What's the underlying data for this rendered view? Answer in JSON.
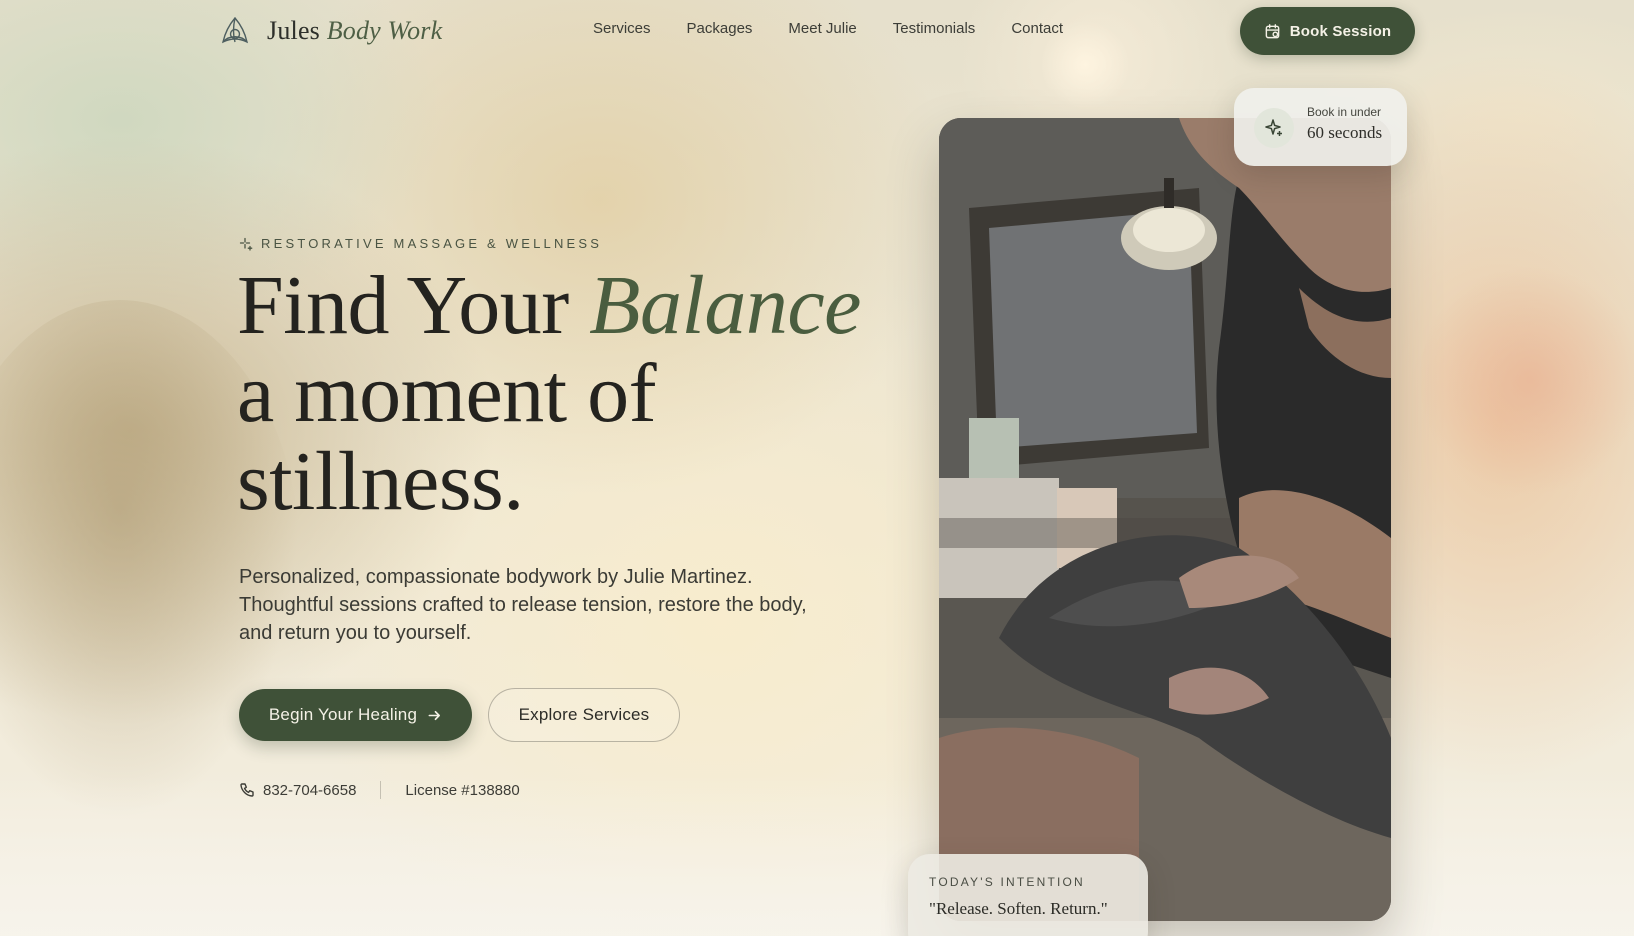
{
  "brand": {
    "name_first": "Jules",
    "name_second": "Body Work",
    "icon": "triquetra-icon"
  },
  "nav": {
    "links": [
      "Services",
      "Packages",
      "Meet Julie",
      "Testimonials",
      "Contact"
    ],
    "book_label": "Book Session",
    "book_icon": "calendar-icon"
  },
  "hero": {
    "eyebrow": "RESTORATIVE MASSAGE & WELLNESS",
    "headline_part1": "Find Your ",
    "headline_accent": "Balance",
    "headline_line2": "a moment of",
    "headline_line3": "stillness.",
    "lede": "Personalized, compassionate bodywork by Julie Martinez. Thoughtful sessions crafted to release tension, restore the body, and return you to yourself.",
    "cta_primary": "Begin Your Healing",
    "cta_secondary": "Explore Services",
    "phone": "832-704-6658",
    "license": "License #138880"
  },
  "badge": {
    "small": "Book in under",
    "big": "60 seconds",
    "icon": "sparkle-icon"
  },
  "intention": {
    "label": "TODAY'S INTENTION",
    "quote": "\"Release. Soften. Return.\""
  },
  "colors": {
    "accent": "#3f5138",
    "accent_text": "#4a5d3f",
    "background": "#ece5d3"
  }
}
